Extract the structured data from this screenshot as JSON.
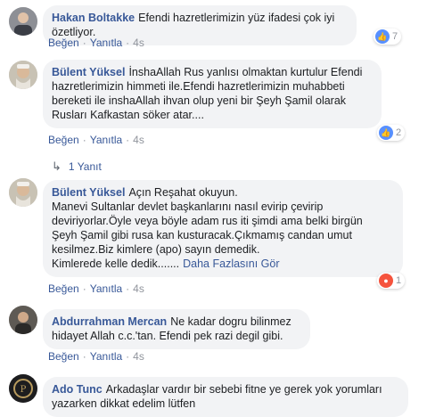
{
  "comments": [
    {
      "author": "Hakan Boltakke",
      "text": "Efendi hazretlerimizin yüz ifadesi çok iyi özetliyor.",
      "actions": {
        "like": "Beğen",
        "reply": "Yanıtla",
        "time": "4s"
      },
      "reaction": {
        "icon": "like-icon",
        "count": "7"
      }
    },
    {
      "author": "Bülent Yüksel",
      "text": "İnshaAllah Rus yanlısı olmaktan kurtulur Efendi hazretlerimizin himmeti ile.Efendi hazretlerimizin muhabbeti bereketi ile inshaAllah ihvan olup yeni bir Şeyh Şamil olarak Rusları Kafkastan söker atar....",
      "actions": {
        "like": "Beğen",
        "reply": "Yanıtla",
        "time": "4s"
      },
      "reaction": {
        "icon": "like-icon",
        "count": "2"
      },
      "replies": "1 Yanıt"
    },
    {
      "author": "Bülent Yüksel",
      "text": "Açın Reşahat okuyun.",
      "text_lines": [
        "Manevi Sultanlar devlet başkanlarını nasıl evirip çevirip",
        "deviriyorlar.Öyle veya böyle adam rus iti şimdi ama belki birgün",
        "Şeyh Şamil gibi rusa kan kusturacak.Çıkmamış candan umut",
        "kesilmez.Biz kimlere (apo) sayın demedik.",
        "Kimlerede kelle dedik......."
      ],
      "more": "Daha Fazlasını Gör",
      "actions": {
        "like": "Beğen",
        "reply": "Yanıtla",
        "time": "4s"
      },
      "reaction": {
        "icon": "angry-icon",
        "count": "1"
      }
    },
    {
      "author": "Abdurrahman Mercan",
      "text": "Ne kadar dogru bilinmez hidayet Allah c.c.'tan. Efendi pek razi degil gibi.",
      "actions": {
        "like": "Beğen",
        "reply": "Yanıtla",
        "time": "4s"
      }
    },
    {
      "author": "Ado Tunc",
      "text": "Arkadaşlar vardır bir sebebi fitne ye gerek yok yorumları yazarken dikkat edelim lütfen"
    }
  ],
  "colors": {
    "link": "#385898",
    "bubble": "#f2f3f5",
    "meta": "#90949c",
    "like": "#5890ff",
    "angry": "#f5533d"
  }
}
